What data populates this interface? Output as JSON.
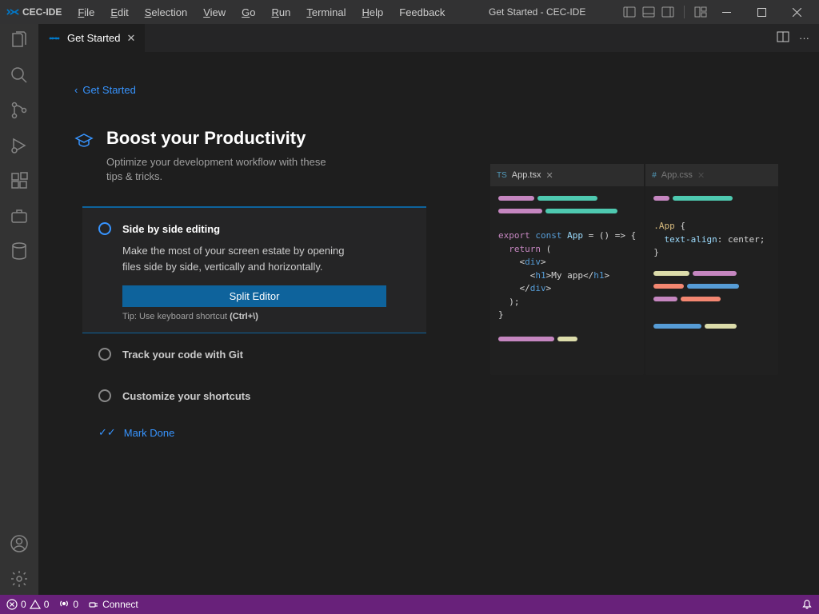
{
  "app": {
    "name": "CEC-IDE"
  },
  "menu": [
    "File",
    "Edit",
    "Selection",
    "View",
    "Go",
    "Run",
    "Terminal",
    "Help",
    "Feedback"
  ],
  "window_title": "Get Started - CEC-IDE",
  "tab": {
    "label": "Get Started"
  },
  "back": {
    "label": "Get Started"
  },
  "section": {
    "title": "Boost your Productivity",
    "subtitle": "Optimize your development workflow with these tips & tricks."
  },
  "steps": {
    "active": {
      "title": "Side by side editing",
      "body": "Make the most of your screen estate by opening files side by side, vertically and horizontally.",
      "button": "Split Editor",
      "tip_prefix": "Tip: Use keyboard shortcut ",
      "tip_key": "(Ctrl+\\)"
    },
    "items": [
      {
        "title": "Track your code with Git"
      },
      {
        "title": "Customize your shortcuts"
      }
    ]
  },
  "mark_done": "Mark Done",
  "preview": {
    "left_file": "App.tsx",
    "right_file": "App.css",
    "code_lines": [
      "export const App = () => {",
      "  return (",
      "    <div>",
      "      <h1>My app</h1>",
      "    </div>",
      "  );",
      "}"
    ],
    "css_lines": [
      ".App {",
      "  text-align: center;",
      "}"
    ]
  },
  "statusbar": {
    "errors": "0",
    "warnings": "0",
    "ports": "0",
    "connect": "Connect"
  }
}
